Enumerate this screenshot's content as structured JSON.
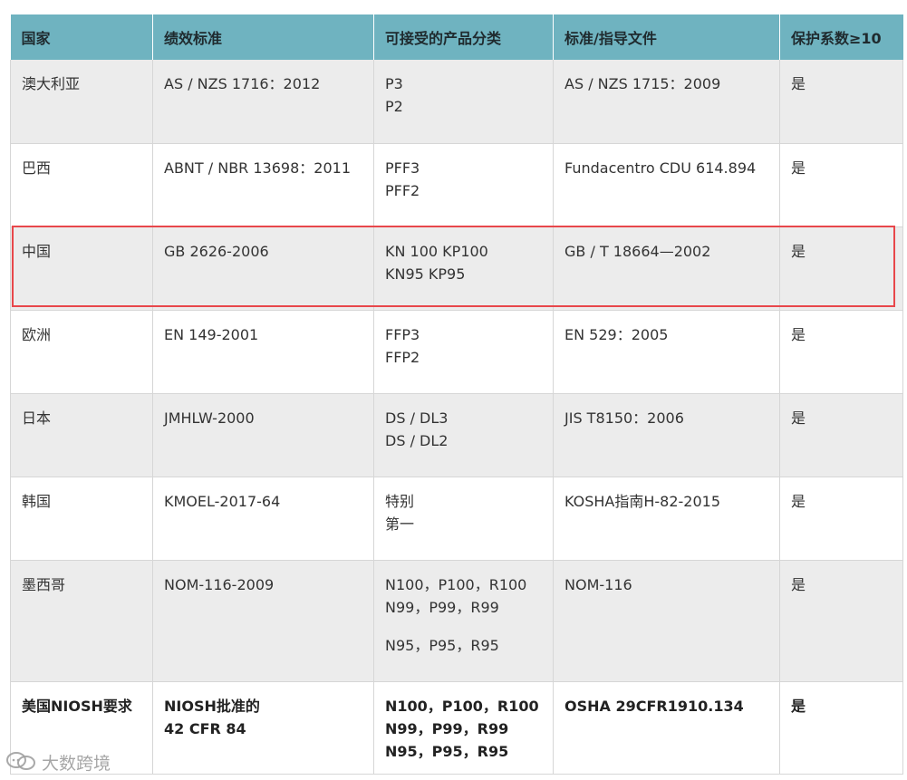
{
  "table": {
    "headers": [
      "国家",
      "绩效标准",
      "可接受的产品分类",
      "标准/指导文件",
      "保护系数≥10"
    ],
    "rows": [
      {
        "country": "澳大利亚",
        "standard": [
          "AS / NZS 1716：2012"
        ],
        "classes": [
          "P3",
          "P2"
        ],
        "guidance": [
          "AS / NZS 1715：2009"
        ],
        "apf": "是"
      },
      {
        "country": "巴西",
        "standard": [
          "ABNT / NBR 13698：2011"
        ],
        "classes": [
          "PFF3",
          "PFF2"
        ],
        "guidance": [
          "Fundacentro CDU 614.894"
        ],
        "apf": "是"
      },
      {
        "country": "中国",
        "standard": [
          "GB 2626-2006"
        ],
        "classes": [
          "KN 100 KP100",
          "KN95 KP95"
        ],
        "guidance": [
          "GB / T 18664—2002"
        ],
        "apf": "是"
      },
      {
        "country": "欧洲",
        "standard": [
          "EN 149-2001"
        ],
        "classes": [
          "FFP3",
          "FFP2"
        ],
        "guidance": [
          "EN 529：2005"
        ],
        "apf": "是"
      },
      {
        "country": "日本",
        "standard": [
          "JMHLW-2000"
        ],
        "classes": [
          "DS / DL3",
          "DS / DL2"
        ],
        "guidance": [
          "JIS T8150：2006"
        ],
        "apf": "是"
      },
      {
        "country": "韩国",
        "standard": [
          "KMOEL-2017-64"
        ],
        "classes": [
          "特别",
          "第一"
        ],
        "guidance": [
          "KOSHA指南H-82-2015"
        ],
        "apf": "是"
      },
      {
        "country": "墨西哥",
        "standard": [
          "NOM-116-2009"
        ],
        "classes": [
          "N100，P100，R100",
          "N99，P99，R99",
          "N95，P95，R95"
        ],
        "guidance": [
          "NOM-116"
        ],
        "apf": "是"
      },
      {
        "country": "美国NIOSH要求",
        "standard": [
          "NIOSH批准的",
          "42 CFR 84"
        ],
        "classes": [
          "N100，P100，R100",
          "N99，P99，R99",
          "N95，P95，R95"
        ],
        "guidance": [
          "OSHA 29CFR1910.134"
        ],
        "apf": "是"
      }
    ]
  },
  "watermark": {
    "text": "大数跨境"
  },
  "colors": {
    "header_bg": "#6fb3c0",
    "stripe_bg": "#ececec",
    "highlight_border": "#e8474b"
  }
}
